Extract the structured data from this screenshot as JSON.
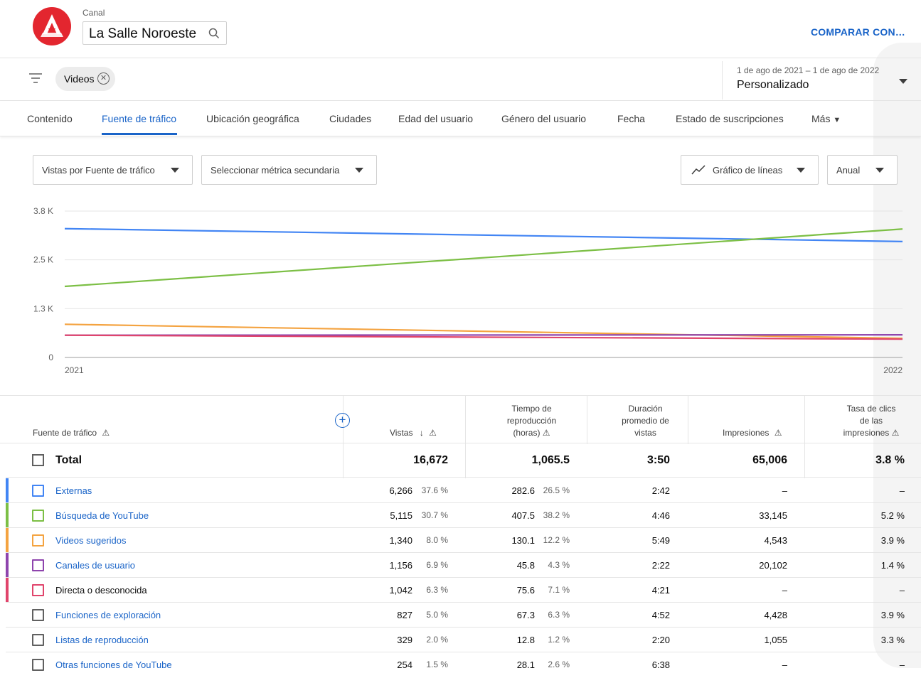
{
  "header": {
    "channel_label": "Canal",
    "channel_name": "La Salle Noroeste",
    "compare_label": "COMPARAR CON…"
  },
  "filters": {
    "chip_label": "Videos",
    "date_range": "1 de ago de 2021 – 1 de ago de 2022",
    "date_preset": "Personalizado"
  },
  "tabs": [
    {
      "label": "Contenido"
    },
    {
      "label": "Fuente de tráfico"
    },
    {
      "label": "Ubicación geográfica"
    },
    {
      "label": "Ciudades"
    },
    {
      "label": "Edad del usuario"
    },
    {
      "label": "Género del usuario"
    },
    {
      "label": "Fecha"
    },
    {
      "label": "Estado de suscripciones"
    },
    {
      "label": "Más"
    }
  ],
  "controls": {
    "metric": "Vistas por Fuente de tráfico",
    "secondary": "Seleccionar métrica secundaria",
    "chart_type": "Gráfico de líneas",
    "period": "Anual"
  },
  "chart_data": {
    "type": "line",
    "x": [
      "2021",
      "2022"
    ],
    "y_ticks": [
      "0",
      "1.3 K",
      "2.5 K",
      "3.8 K"
    ],
    "y_tick_values": [
      0,
      1250,
      2500,
      3750
    ],
    "ylim": [
      0,
      3750
    ],
    "grid": true,
    "series": [
      {
        "name": "Externas",
        "color": "#4285f4",
        "values": [
          3300,
          2970
        ]
      },
      {
        "name": "Búsqueda de YouTube",
        "color": "#7cbf45",
        "values": [
          1820,
          3290
        ]
      },
      {
        "name": "Videos sugeridos",
        "color": "#f4a340",
        "values": [
          850,
          490
        ]
      },
      {
        "name": "Canales de usuario",
        "color": "#8e44ad",
        "values": [
          570,
          580
        ]
      },
      {
        "name": "Directa o desconocida",
        "color": "#e0446b",
        "values": [
          570,
          470
        ]
      }
    ]
  },
  "table": {
    "headers": {
      "source": "Fuente de tráfico",
      "views": "Vistas",
      "watch_time": [
        "Tiempo de",
        "reproducción",
        "(horas)"
      ],
      "avg_duration": [
        "Duración",
        "promedio de",
        "vistas"
      ],
      "impressions": "Impresiones",
      "ctr": [
        "Tasa de clics",
        "de las",
        "impresiones"
      ]
    },
    "total": {
      "label": "Total",
      "views": "16,672",
      "watch_time": "1,065.5",
      "avg_duration": "3:50",
      "impressions": "65,006",
      "ctr": "3.8 %"
    },
    "rows": [
      {
        "source": "Externas",
        "color": "#4285f4",
        "link": true,
        "views": "6,266",
        "views_pct": "37.6 %",
        "watch": "282.6",
        "watch_pct": "26.5 %",
        "duration": "2:42",
        "impressions": "–",
        "ctr": "–"
      },
      {
        "source": "Búsqueda de YouTube",
        "color": "#7cbf45",
        "link": true,
        "views": "5,115",
        "views_pct": "30.7 %",
        "watch": "407.5",
        "watch_pct": "38.2 %",
        "duration": "4:46",
        "impressions": "33,145",
        "ctr": "5.2 %"
      },
      {
        "source": "Videos sugeridos",
        "color": "#f4a340",
        "link": true,
        "views": "1,340",
        "views_pct": "8.0 %",
        "watch": "130.1",
        "watch_pct": "12.2 %",
        "duration": "5:49",
        "impressions": "4,543",
        "ctr": "3.9 %"
      },
      {
        "source": "Canales de usuario",
        "color": "#8e44ad",
        "link": true,
        "views": "1,156",
        "views_pct": "6.9 %",
        "watch": "45.8",
        "watch_pct": "4.3 %",
        "duration": "2:22",
        "impressions": "20,102",
        "ctr": "1.4 %"
      },
      {
        "source": "Directa o desconocida",
        "color": "#e0446b",
        "link": false,
        "views": "1,042",
        "views_pct": "6.3 %",
        "watch": "75.6",
        "watch_pct": "7.1 %",
        "duration": "4:21",
        "impressions": "–",
        "ctr": "–"
      },
      {
        "source": "Funciones de exploración",
        "color": "",
        "link": true,
        "views": "827",
        "views_pct": "5.0 %",
        "watch": "67.3",
        "watch_pct": "6.3 %",
        "duration": "4:52",
        "impressions": "4,428",
        "ctr": "3.9 %"
      },
      {
        "source": "Listas de reproducción",
        "color": "",
        "link": true,
        "views": "329",
        "views_pct": "2.0 %",
        "watch": "12.8",
        "watch_pct": "1.2 %",
        "duration": "2:20",
        "impressions": "1,055",
        "ctr": "3.3 %"
      },
      {
        "source": "Otras funciones de YouTube",
        "color": "",
        "link": true,
        "views": "254",
        "views_pct": "1.5 %",
        "watch": "28.1",
        "watch_pct": "2.6 %",
        "duration": "6:38",
        "impressions": "–",
        "ctr": "–"
      }
    ]
  }
}
